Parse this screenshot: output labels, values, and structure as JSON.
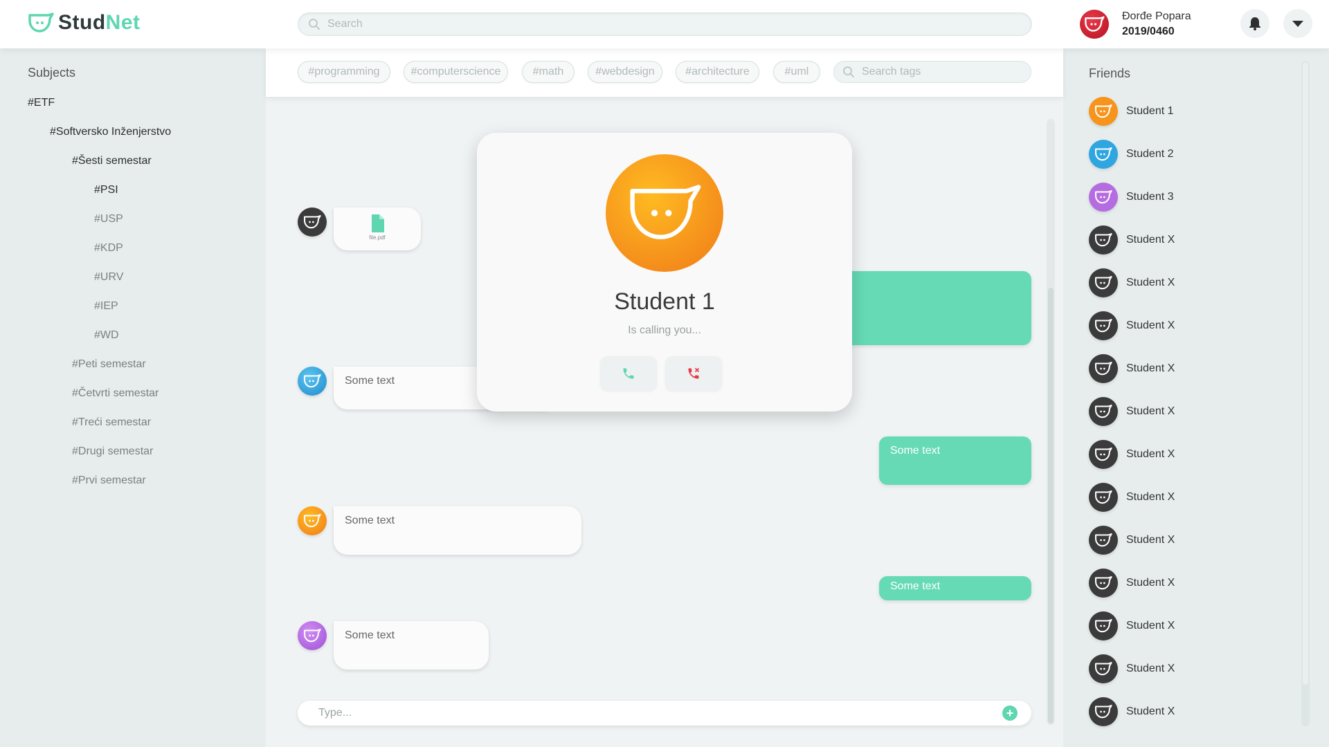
{
  "brand": {
    "logo_prefix": "Stud",
    "logo_accent": "Net",
    "accent_color": "#5fd6b0"
  },
  "search": {
    "placeholder": "Search"
  },
  "user": {
    "name": "Đorđe Popara",
    "id": "2019/0460"
  },
  "subjects": {
    "title": "Subjects",
    "items": [
      {
        "label": "#ETF",
        "level": 0,
        "active": true
      },
      {
        "label": "#Softversko Inženjerstvo",
        "level": 1,
        "active": true
      },
      {
        "label": "#Šesti semestar",
        "level": 2,
        "active": true
      },
      {
        "label": "#PSI",
        "level": 3,
        "active": true
      },
      {
        "label": "#USP",
        "level": 3,
        "active": false
      },
      {
        "label": "#KDP",
        "level": 3,
        "active": false
      },
      {
        "label": "#URV",
        "level": 3,
        "active": false
      },
      {
        "label": "#IEP",
        "level": 3,
        "active": false
      },
      {
        "label": "#WD",
        "level": 3,
        "active": false
      },
      {
        "label": "#Peti semestar",
        "level": 2,
        "active": false
      },
      {
        "label": "#Četvrti semestar",
        "level": 2,
        "active": false
      },
      {
        "label": "#Treći semestar",
        "level": 2,
        "active": false
      },
      {
        "label": "#Drugi semestar",
        "level": 2,
        "active": false
      },
      {
        "label": "#Prvi semestar",
        "level": 2,
        "active": false
      }
    ]
  },
  "tags": {
    "items": [
      "#programming",
      "#computerscience",
      "#math",
      "#webdesign",
      "#architecture",
      "#uml"
    ],
    "search_placeholder": "Search tags"
  },
  "chat": {
    "file_name": "file.pdf",
    "messages": [
      {
        "text": "Some text",
        "side": "in"
      },
      {
        "text": "Some text",
        "side": "out"
      },
      {
        "text": "Some text",
        "side": "in"
      },
      {
        "text": "Some text",
        "side": "out"
      },
      {
        "text": "Some text",
        "side": "in"
      }
    ],
    "input_placeholder": "Type...",
    "add_symbol": "+"
  },
  "call": {
    "caller": "Student 1",
    "status": "Is calling you..."
  },
  "friends": {
    "title": "Friends",
    "items": [
      {
        "name": "Student 1",
        "color": "#f6941c"
      },
      {
        "name": "Student 2",
        "color": "#2fa6e0"
      },
      {
        "name": "Student 3",
        "color": "#b56ce0"
      },
      {
        "name": "Student X",
        "color": "#3b3b3b"
      },
      {
        "name": "Student X",
        "color": "#3b3b3b"
      },
      {
        "name": "Student X",
        "color": "#3b3b3b"
      },
      {
        "name": "Student X",
        "color": "#3b3b3b"
      },
      {
        "name": "Student X",
        "color": "#3b3b3b"
      },
      {
        "name": "Student X",
        "color": "#3b3b3b"
      },
      {
        "name": "Student X",
        "color": "#3b3b3b"
      },
      {
        "name": "Student X",
        "color": "#3b3b3b"
      },
      {
        "name": "Student X",
        "color": "#3b3b3b"
      },
      {
        "name": "Student X",
        "color": "#3b3b3b"
      },
      {
        "name": "Student X",
        "color": "#3b3b3b"
      },
      {
        "name": "Student X",
        "color": "#3b3b3b"
      }
    ]
  },
  "icons": {
    "logo": "studnet-logo-icon",
    "search": "search-icon",
    "bell": "bell-icon",
    "dropdown": "chevron-down-icon",
    "file": "file-icon",
    "accept": "phone-icon",
    "decline": "phone-decline-icon",
    "add": "plus-icon"
  }
}
